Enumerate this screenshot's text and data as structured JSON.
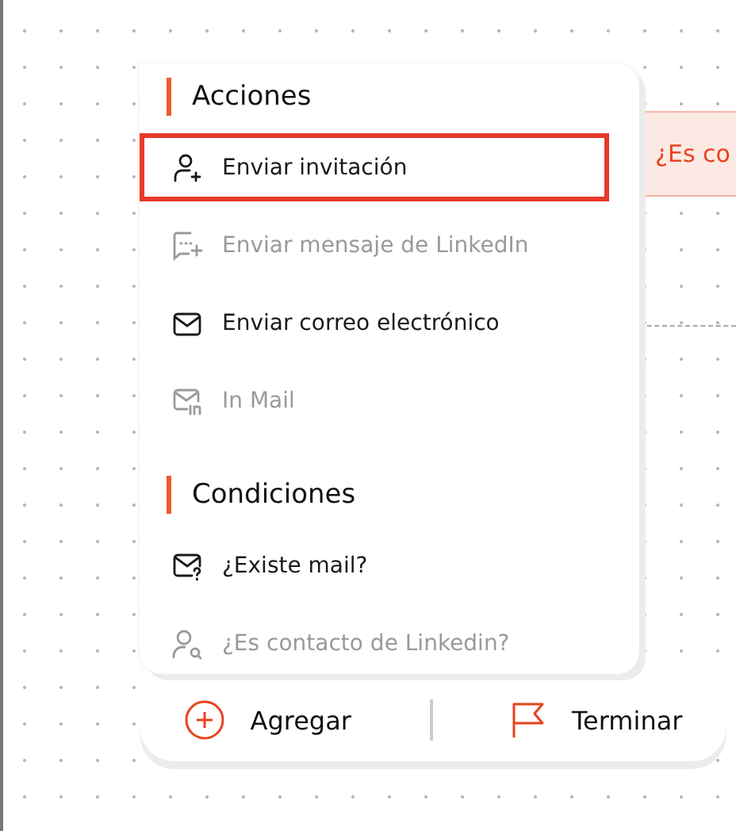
{
  "node": {
    "label": "¿Es co"
  },
  "sections": [
    {
      "title": "Acciones",
      "items": [
        {
          "kind": "invite",
          "label": "Enviar invitación",
          "disabled": false,
          "selected": true
        },
        {
          "kind": "message",
          "label": "Enviar mensaje de LinkedIn",
          "disabled": true,
          "selected": false
        },
        {
          "kind": "mail",
          "label": "Enviar correo electrónico",
          "disabled": false,
          "selected": false
        },
        {
          "kind": "inmail",
          "label": "In Mail",
          "disabled": true,
          "selected": false
        }
      ]
    },
    {
      "title": "Condiciones",
      "items": [
        {
          "kind": "mailq",
          "label": "¿Existe mail?",
          "disabled": false,
          "selected": false
        },
        {
          "kind": "usersearch",
          "label": "¿Es contacto de Linkedin?",
          "disabled": true,
          "selected": false
        }
      ]
    }
  ],
  "footer": {
    "add": "Agregar",
    "finish": "Terminar"
  }
}
